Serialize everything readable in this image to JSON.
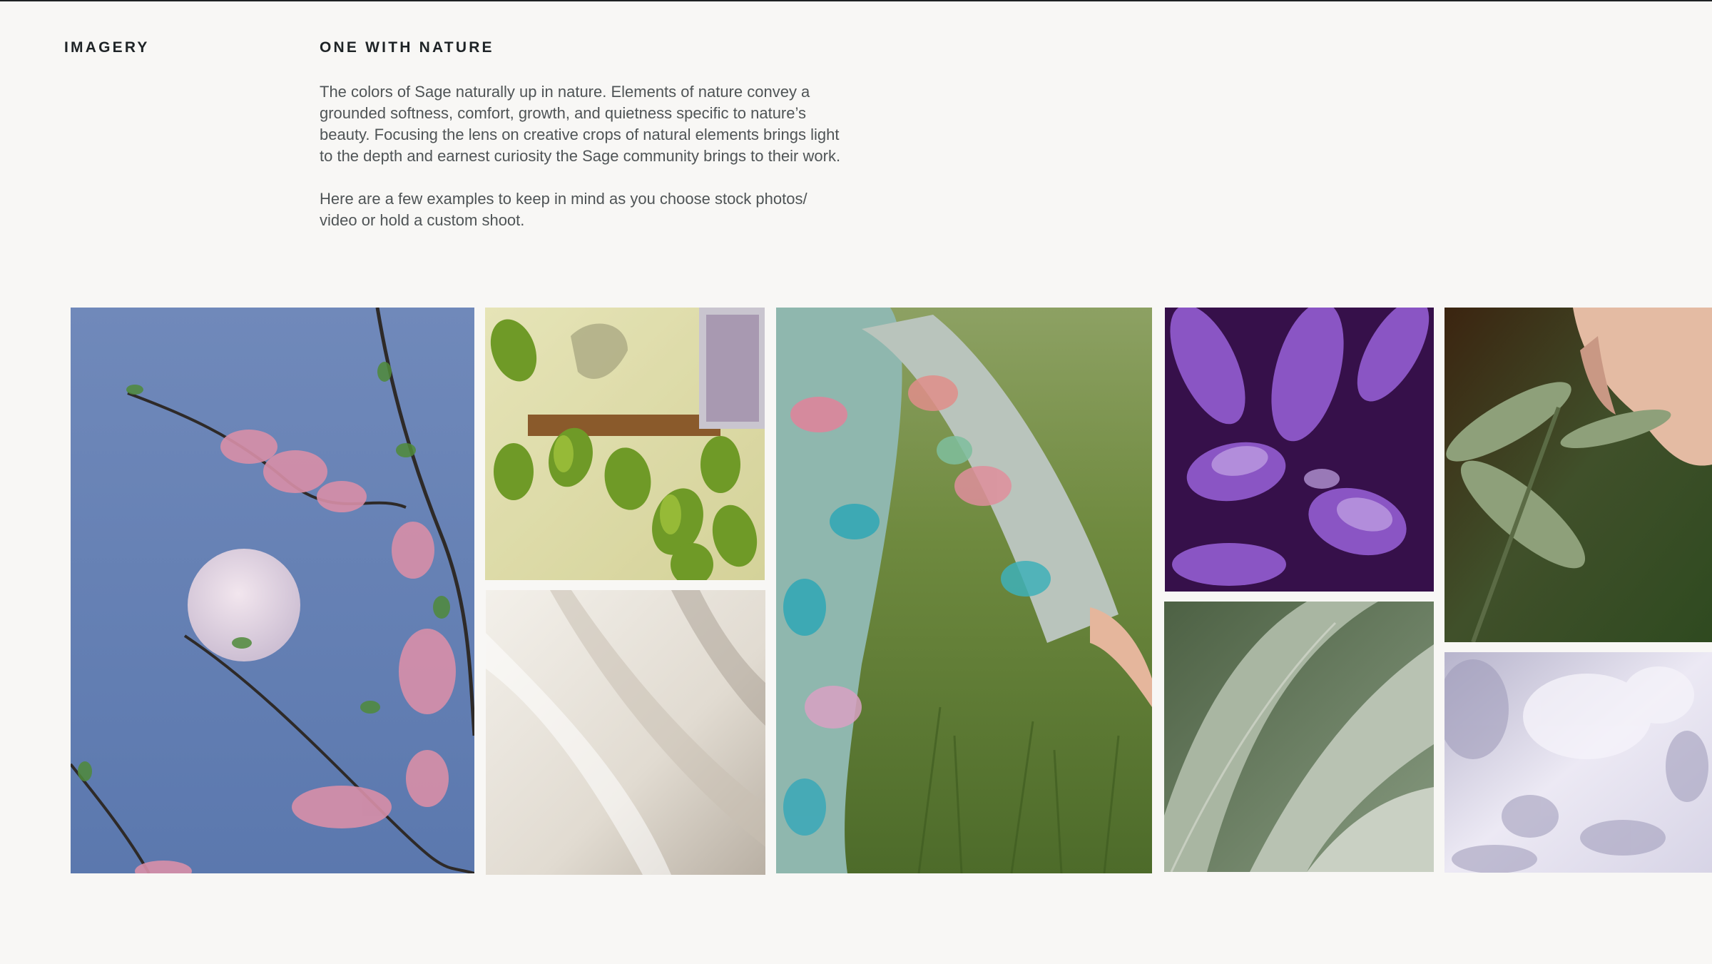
{
  "section": {
    "label": "IMAGERY",
    "heading": "ONE WITH NATURE",
    "paragraphs": [
      "The colors of Sage naturally up in nature. Elements of nature convey a grounded softness, comfort, growth, and quietness specific to nature’s beauty. Focusing the lens on creative crops of natural elements brings light to the depth and earnest curiosity the Sage community brings to their work.",
      "Here are a few examples to keep in mind as you choose stock photos/ video or hold a custom shoot."
    ]
  },
  "gallery": [
    {
      "name": "moon-blossom-photo",
      "colors": [
        "#6f88b9",
        "#5d79ad"
      ]
    },
    {
      "name": "pothos-plant-photo",
      "colors": [
        "#e9e8b7",
        "#7a9d2a"
      ]
    },
    {
      "name": "white-fabric-photo",
      "colors": [
        "#efebe4",
        "#b5aca0"
      ]
    },
    {
      "name": "floral-dress-grass-photo",
      "colors": [
        "#7f9a55",
        "#4f6b2c"
      ]
    },
    {
      "name": "purple-sage-leaves-photo",
      "colors": [
        "#3a1150",
        "#9b6cd3"
      ]
    },
    {
      "name": "sage-leaf-closeup-photo",
      "colors": [
        "#b4bfb0",
        "#74856d"
      ]
    },
    {
      "name": "hand-touching-sage-photo",
      "colors": [
        "#3b220f",
        "#e7bfa8"
      ]
    },
    {
      "name": "leaf-shadow-photo",
      "colors": [
        "#e7e4f0",
        "#a7a3bf"
      ]
    }
  ]
}
